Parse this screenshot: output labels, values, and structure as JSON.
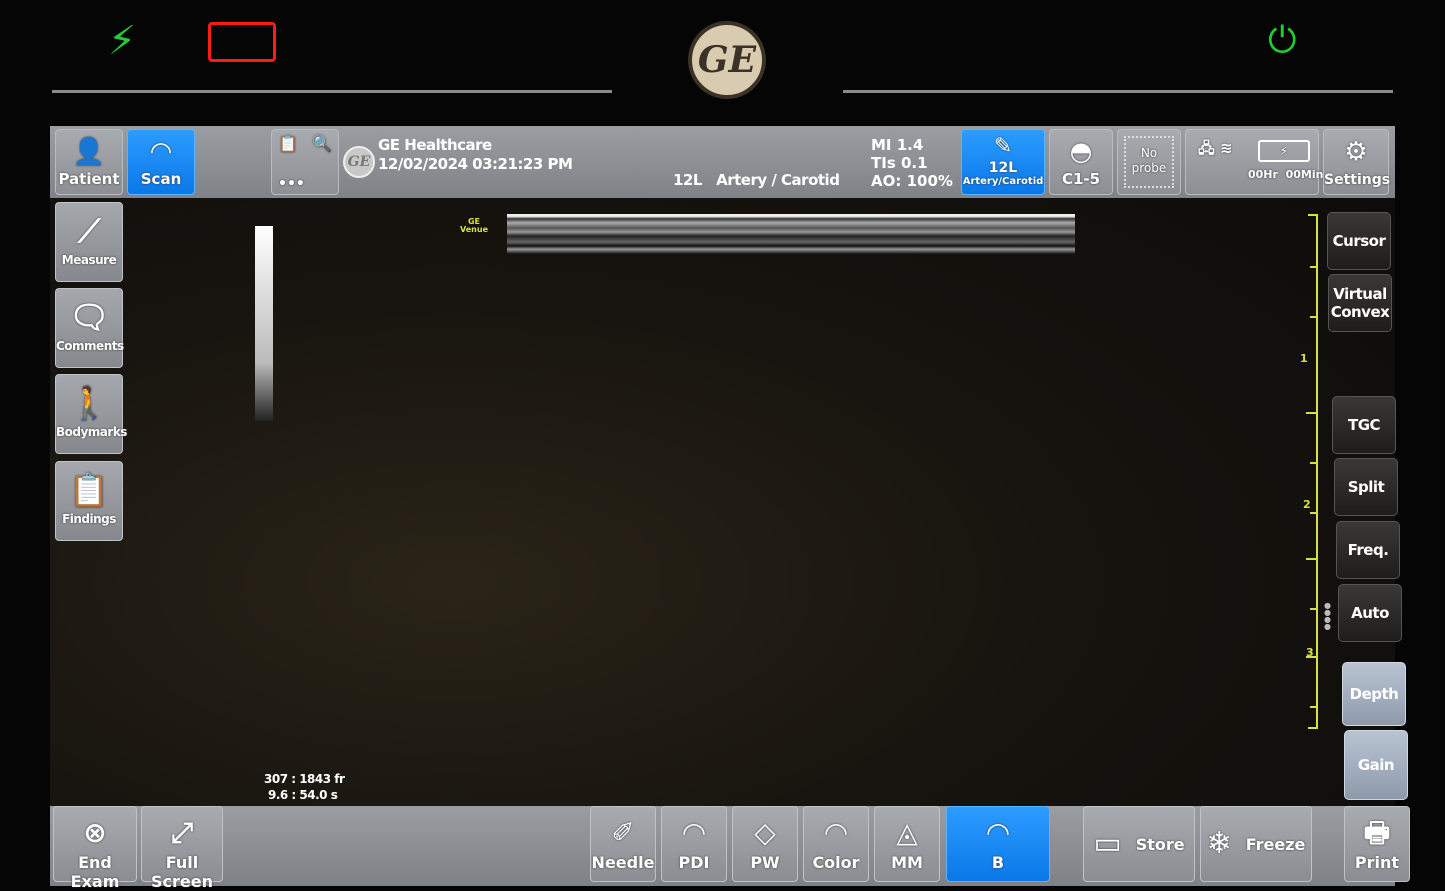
{
  "bezel": {
    "power_plug_icon": "plug-icon",
    "battery_icon": "battery-empty-icon",
    "logo": "GE",
    "power_button_icon": "power-icon"
  },
  "topbar": {
    "patient": "Patient",
    "scan": "Scan",
    "company": "GE Healthcare",
    "datetime": "12/02/2024 03:21:23 PM",
    "probe_preset": "12L   Artery / Carotid",
    "mi": "MI 1.4",
    "tis": "TIs 0.1",
    "ao": "AO: 100%",
    "probe1_name": "12L",
    "probe1_preset": "Artery/Carotid",
    "probe2": "C1-5",
    "probe3": "No probe",
    "timer": "00Hr  00Min",
    "settings": "Settings"
  },
  "left": {
    "measure": "Measure",
    "comments": "Comments",
    "bodymarks": "Bodymarks",
    "findings": "Findings"
  },
  "right": {
    "cursor": "Cursor",
    "virtual_convex": "Virtual Convex",
    "tgc": "TGC",
    "split": "Split",
    "freq": "Freq.",
    "auto": "Auto",
    "depth": "Depth",
    "gain": "Gain"
  },
  "image": {
    "watermark": "GE Venue",
    "frames": "307 : 1843 fr",
    "time": "9.6 : 54.0 s",
    "depth_labels": [
      "1",
      "2",
      "3"
    ]
  },
  "bottom": {
    "end_exam": "End Exam",
    "full_screen": "Full Screen",
    "needle": "Needle",
    "pdi": "PDI",
    "pw": "PW",
    "color": "Color",
    "mm": "MM",
    "b": "B",
    "store": "Store",
    "freeze": "Freeze",
    "print": "Print"
  },
  "colors": {
    "accent": "#0a84ff",
    "scale": "#d8e23a",
    "plug": "#22cc33",
    "battery": "#ff1a1a"
  }
}
